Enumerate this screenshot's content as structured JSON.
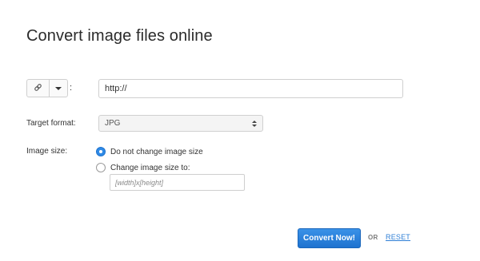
{
  "header": {
    "title": "Convert image files online"
  },
  "source": {
    "link_icon": "link-icon",
    "dropdown_icon": "chevron-down-icon",
    "separator": ":",
    "url_value": "http://"
  },
  "target_format": {
    "label": "Target format:",
    "selected": "JPG",
    "icon": "sort-arrows-icon"
  },
  "image_size": {
    "label": "Image size:",
    "options": [
      {
        "label": "Do not change image size",
        "checked": true
      },
      {
        "label": "Change image size to:",
        "checked": false
      }
    ],
    "size_placeholder": "[width]x[height]"
  },
  "actions": {
    "convert_label": "Convert Now!",
    "or_label": "OR",
    "reset_label": "RESET"
  },
  "colors": {
    "accent": "#2f8ae6",
    "link": "#2f7fd6"
  }
}
